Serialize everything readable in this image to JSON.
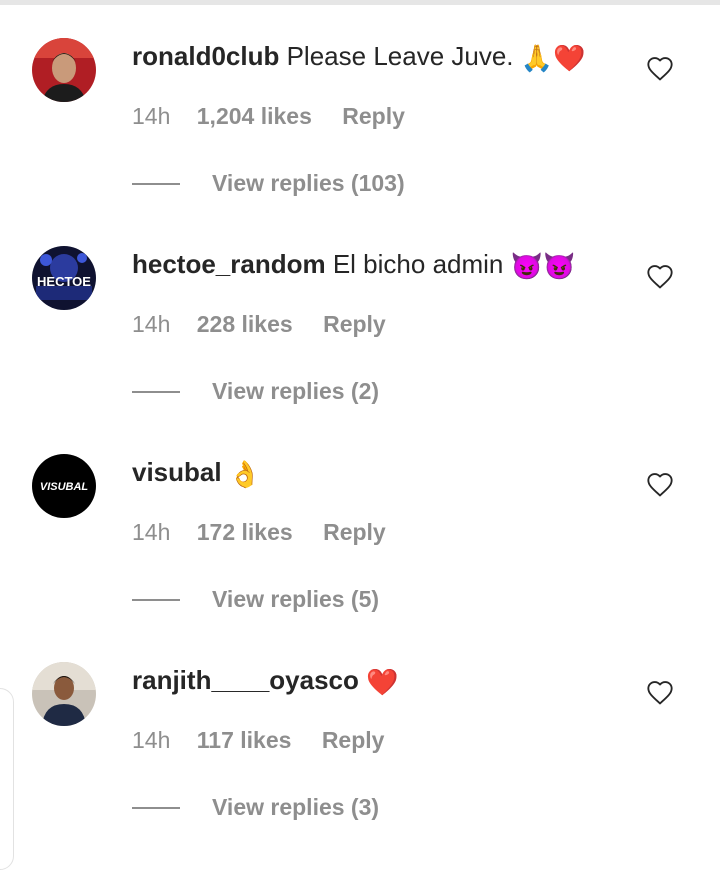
{
  "comments": [
    {
      "username": "ronald0club",
      "text": "Please Leave Juve.",
      "emoji": "🙏❤️",
      "time": "14h",
      "likes": "1,204 likes",
      "reply": "Reply",
      "view_replies": "View replies (103)"
    },
    {
      "username": "hectoe_random",
      "text": "El bicho admin",
      "emoji": "😈😈",
      "avatar_text": "HECTOE",
      "time": "14h",
      "likes": "228 likes",
      "reply": "Reply",
      "view_replies": "View replies (2)"
    },
    {
      "username": "visubal",
      "text": "",
      "emoji": "👌",
      "avatar_text": "VISUBAL",
      "time": "14h",
      "likes": "172 likes",
      "reply": "Reply",
      "view_replies": "View replies (5)"
    },
    {
      "username": "ranjith____oyasco",
      "text": "",
      "emoji": "❤️",
      "time": "14h",
      "likes": "117 likes",
      "reply": "Reply",
      "view_replies": "View replies (3)"
    }
  ],
  "colors": {
    "text": "#262626",
    "muted": "#8e8e8e",
    "divider": "#e6e6e6"
  }
}
